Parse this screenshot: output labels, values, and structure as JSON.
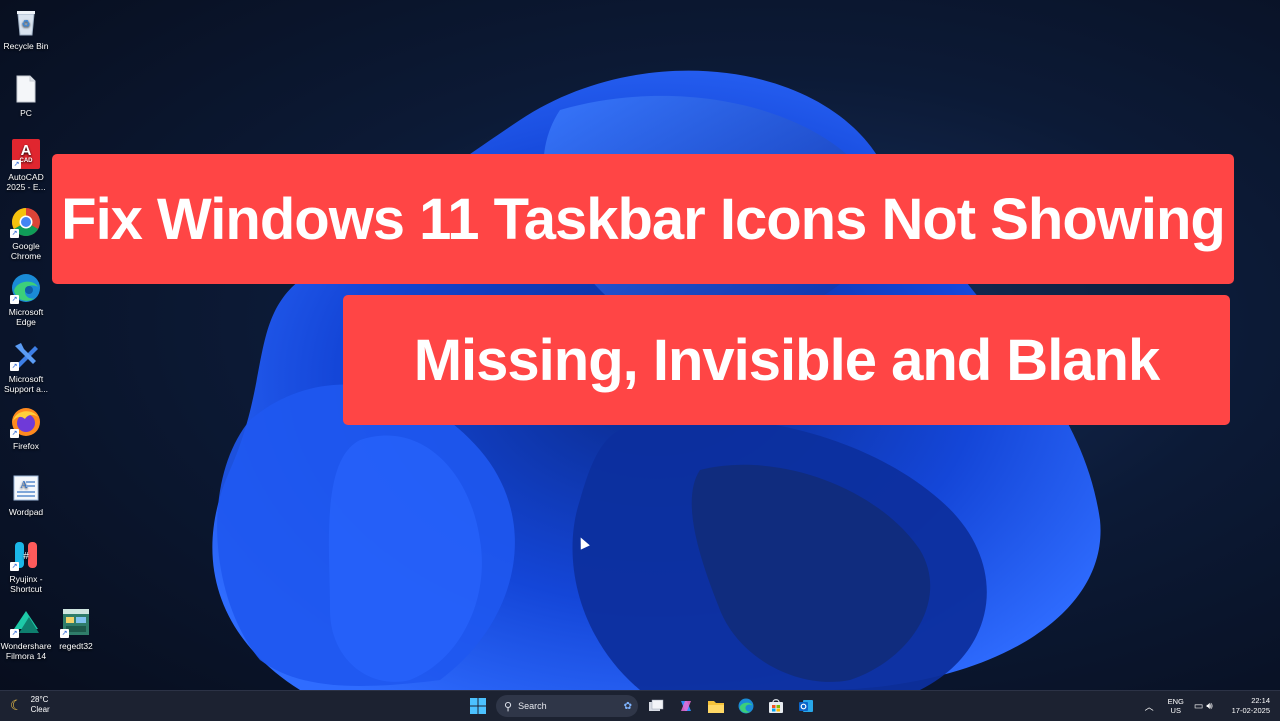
{
  "desktop": {
    "icons": [
      {
        "label": "Recycle Bin",
        "icon": "recycle-bin-icon"
      },
      {
        "label": "PC",
        "icon": "pc-icon"
      },
      {
        "label": "AutoCAD 2025 - E...",
        "icon": "autocad-icon"
      },
      {
        "label": "Google Chrome",
        "icon": "chrome-icon"
      },
      {
        "label": "Microsoft Edge",
        "icon": "edge-icon"
      },
      {
        "label": "Microsoft Support a...",
        "icon": "support-icon"
      },
      {
        "label": "Firefox",
        "icon": "firefox-icon"
      },
      {
        "label": "Wordpad",
        "icon": "wordpad-icon"
      },
      {
        "label": "Ryujinx - Shortcut",
        "icon": "ryujinx-icon"
      },
      {
        "label": "Wondershare Filmora 14",
        "icon": "filmora-icon"
      },
      {
        "label": "regedt32",
        "icon": "regedit-icon"
      }
    ],
    "autocad_badge": "A",
    "autocad_sub": "CAD"
  },
  "banners": {
    "title_line1": "Fix Windows 11 Taskbar Icons Not Showing",
    "title_line2": "Missing, Invisible and Blank",
    "color": "#ff4545"
  },
  "taskbar": {
    "weather": {
      "temp": "28°C",
      "condition": "Clear"
    },
    "search": {
      "label": "Search"
    },
    "pinned": [
      "start-icon",
      "search-box",
      "task-view-icon",
      "copilot-icon",
      "file-explorer-icon",
      "edge-icon",
      "store-icon",
      "outlook-icon"
    ],
    "tray": {
      "lang_line1": "ENG",
      "lang_line2": "US",
      "time": "22:14",
      "date": "17-02-2025"
    }
  }
}
